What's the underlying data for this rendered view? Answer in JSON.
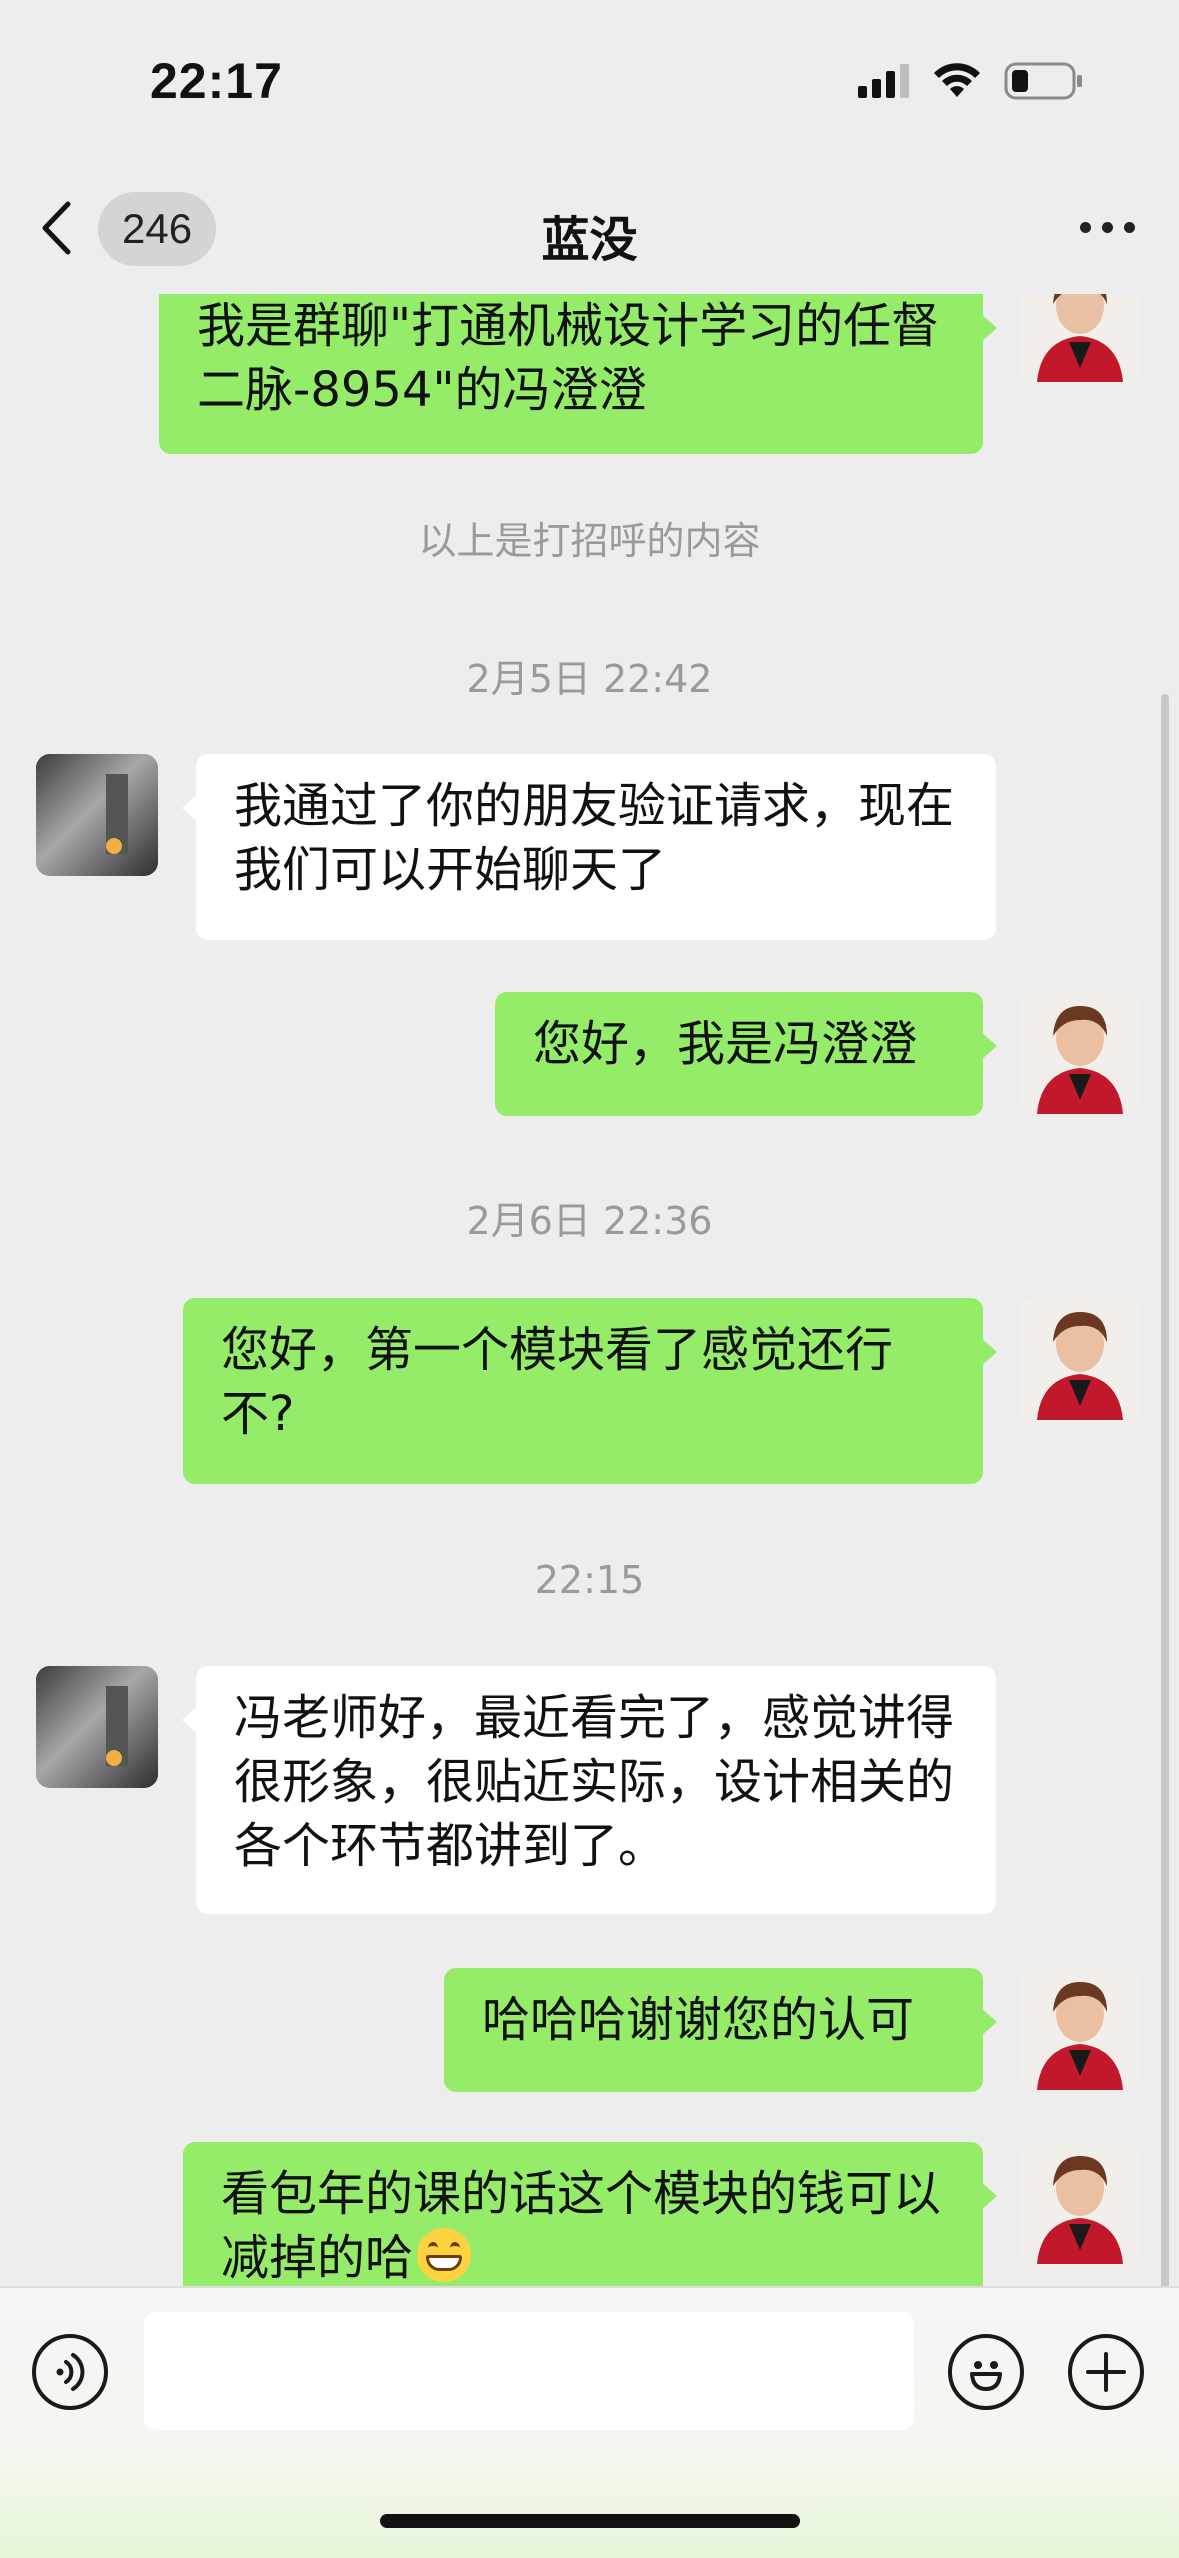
{
  "status_bar": {
    "time": "22:17"
  },
  "nav": {
    "unread_count": "246",
    "title": "蓝没"
  },
  "messages": {
    "m1": "我是群聊\"打通机械设计学习的任督二脉-8954\"的冯澄澄",
    "sys_greeting": "以上是打招呼的内容",
    "ts1": "2月5日 22:42",
    "m2": "我通过了你的朋友验证请求，现在我们可以开始聊天了",
    "m3": "您好，我是冯澄澄",
    "ts2": "2月6日 22:36",
    "m4": "您好，第一个模块看了感觉还行不?",
    "ts3": "22:15",
    "m5": "冯老师好，最近看完了，感觉讲得很形象，很贴近实际，设计相关的各个环节都讲到了。",
    "m6": "哈哈哈谢谢您的认可",
    "m7": "看包年的课的话这个模块的钱可以减掉的哈"
  },
  "emoji": {
    "m7_trailing": "grinning-face-emoji"
  },
  "colors": {
    "bubble_me": "#95ec69",
    "bubble_them": "#ffffff",
    "background": "#ededed"
  }
}
